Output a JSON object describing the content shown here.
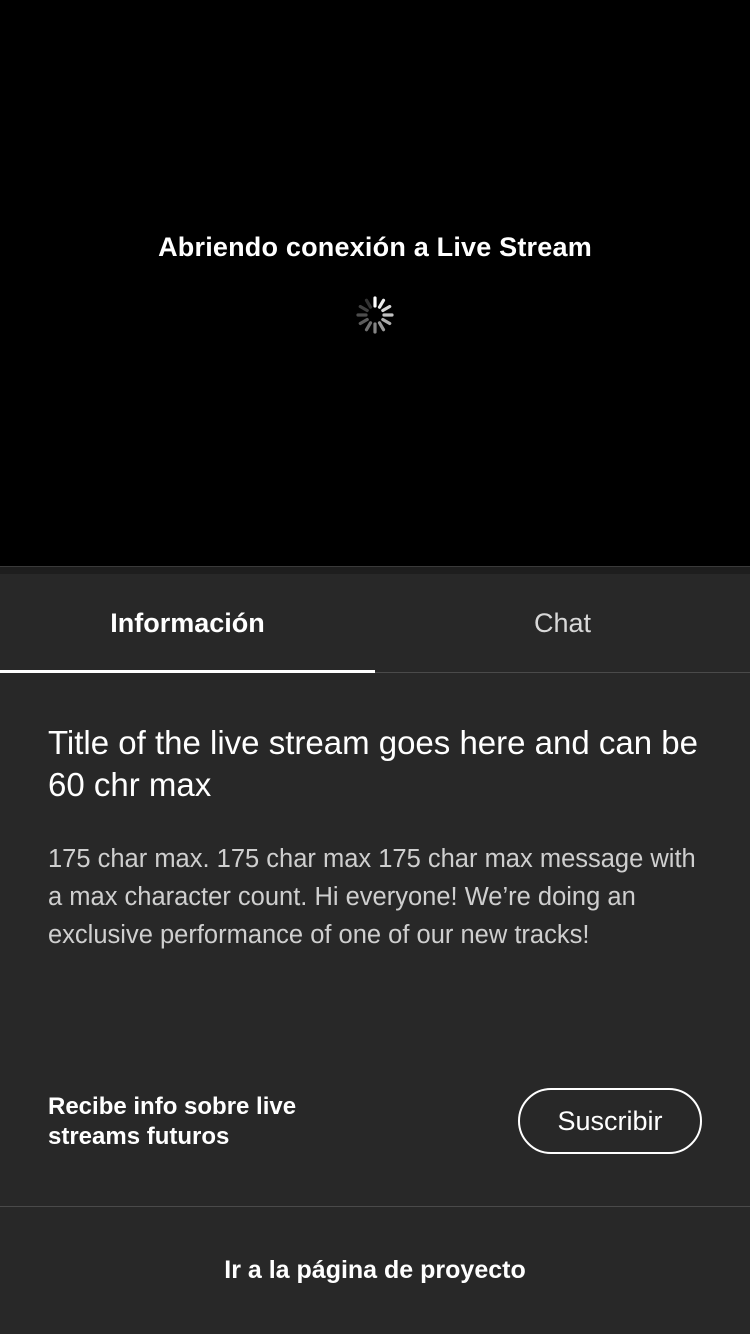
{
  "player": {
    "status_text": "Abriendo conexión a Live Stream",
    "loading_icon": "spinner-icon",
    "background_color": "#000000"
  },
  "tabs": [
    {
      "label": "Información",
      "active": true
    },
    {
      "label": "Chat",
      "active": false
    }
  ],
  "info": {
    "title": "Title of the live stream goes here and can be 60 chr max",
    "description": "175 char max. 175 char max 175 char max message with a max character count. Hi everyone! We’re doing an exclusive performance of one of our new tracks!"
  },
  "subscribe": {
    "prompt": "Recibe info sobre live streams futuros",
    "button_label": "Suscribir"
  },
  "footer": {
    "project_link_label": "Ir a la página de proyecto"
  },
  "colors": {
    "panel_background": "#282828",
    "text_primary": "#ffffff",
    "text_secondary": "#cfcfcf",
    "divider": "#4a4a4a"
  }
}
